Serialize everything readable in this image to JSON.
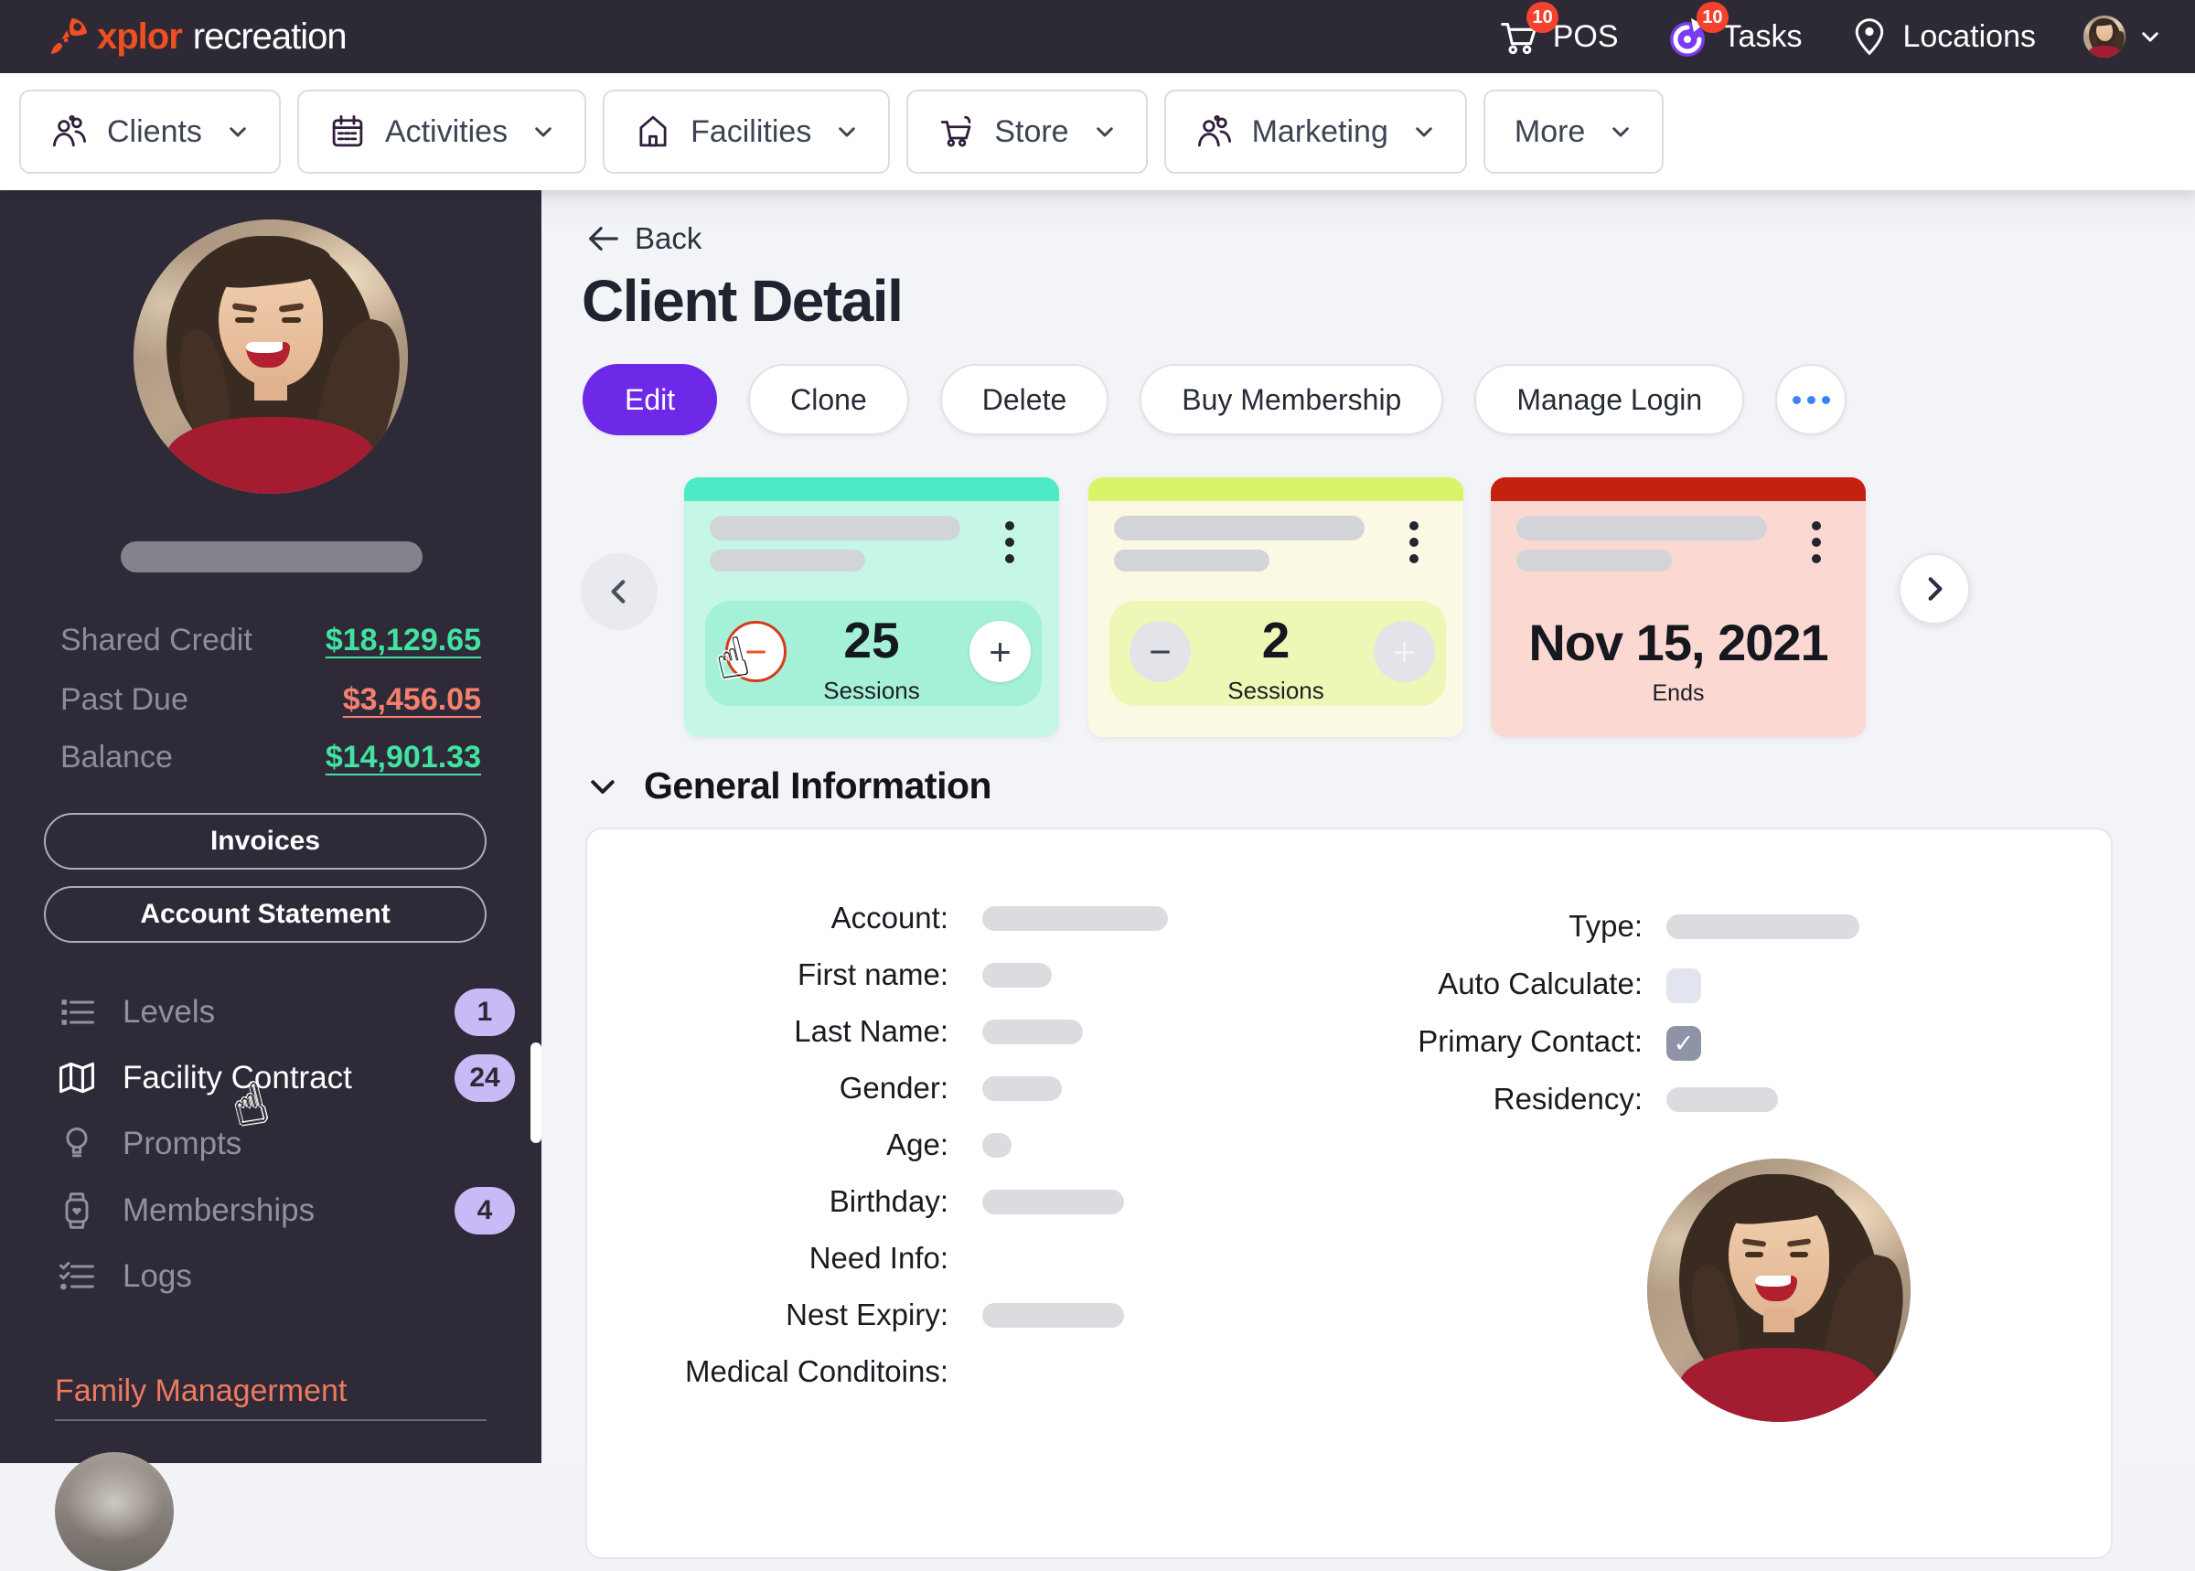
{
  "topbar": {
    "brand": "xplor",
    "brand_suffix": "recreation",
    "pos_label": "POS",
    "pos_badge": "10",
    "tasks_label": "Tasks",
    "tasks_badge": "10",
    "locations_label": "Locations"
  },
  "nav": {
    "clients": "Clients",
    "activities": "Activities",
    "facilities": "Facilities",
    "store": "Store",
    "marketing": "Marketing",
    "more": "More"
  },
  "sidebar": {
    "shared_credit_label": "Shared Credit",
    "shared_credit_value": "$18,129.65",
    "past_due_label": "Past Due",
    "past_due_value": "$3,456.05",
    "balance_label": "Balance",
    "balance_value": "$14,901.33",
    "invoices_label": "Invoices",
    "statement_label": "Account Statement",
    "menu": [
      {
        "label": "Levels",
        "badge": "1"
      },
      {
        "label": "Facility Contract",
        "badge": "24"
      },
      {
        "label": "Prompts",
        "badge": ""
      },
      {
        "label": "Memberships",
        "badge": "4"
      },
      {
        "label": "Logs",
        "badge": ""
      }
    ],
    "family_label": "Family Managerment"
  },
  "main": {
    "back": "Back",
    "title": "Client Detail",
    "edit": "Edit",
    "clone": "Clone",
    "delete": "Delete",
    "buy_membership": "Buy Membership",
    "manage_login": "Manage Login",
    "cards": [
      {
        "value": "25",
        "unit": "Sessions",
        "theme": "green"
      },
      {
        "value": "2",
        "unit": "Sessions",
        "theme": "yellow"
      },
      {
        "value": "Nov 15, 2021",
        "unit": "Ends",
        "theme": "red"
      }
    ],
    "section_title": "General Information",
    "form_left": [
      {
        "label": "Account:"
      },
      {
        "label": "First name:"
      },
      {
        "label": "Last Name:"
      },
      {
        "label": "Gender:"
      },
      {
        "label": "Age:"
      },
      {
        "label": "Birthday:"
      },
      {
        "label": "Need Info:"
      },
      {
        "label": "Nest Expiry:"
      },
      {
        "label": "Medical Conditoins:"
      }
    ],
    "form_right": [
      {
        "label": "Type:"
      },
      {
        "label": "Auto Calculate:"
      },
      {
        "label": "Primary Contact:"
      },
      {
        "label": "Residency:"
      }
    ]
  },
  "glyphs": {
    "minus": "−",
    "plus": "+",
    "check": "✓",
    "hand_cursor": "☝"
  },
  "colors": {
    "accent_purple": "#6d28e8",
    "badge_red": "#f5422e",
    "badge_purple": "#c9b9f6",
    "money_green": "#42e2a1",
    "money_red": "#f5806e",
    "card_green_top": "#4deac6",
    "card_yellow_top": "#d8f56a",
    "card_red_top": "#c62011",
    "topbar_bg": "#2d2a36",
    "sidebar_bg": "#2e2a38"
  }
}
